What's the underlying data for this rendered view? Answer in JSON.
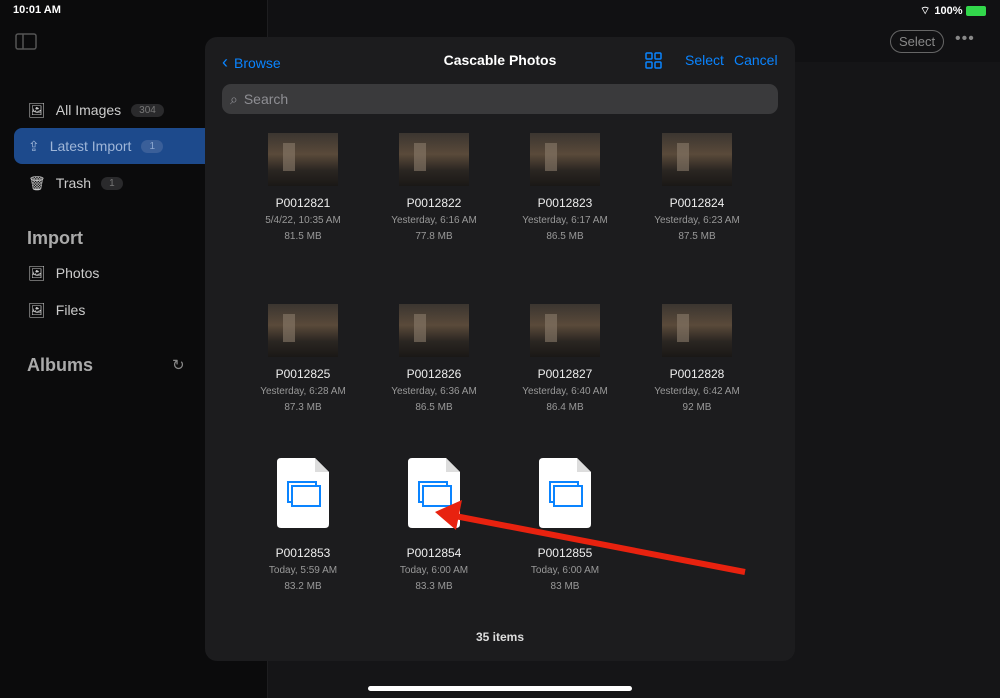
{
  "status": {
    "time": "10:01 AM",
    "battery": "100%"
  },
  "sidebar": {
    "items": [
      {
        "label": "All Images",
        "count": "304",
        "icon": "photo-icon"
      },
      {
        "label": "Latest Import",
        "count": "1",
        "icon": "import-icon"
      },
      {
        "label": "Trash",
        "count": "1",
        "icon": "trash-icon"
      }
    ],
    "import_title": "Import",
    "import_items": [
      {
        "label": "Photos"
      },
      {
        "label": "Files"
      }
    ],
    "albums_title": "Albums"
  },
  "toolbar": {
    "select_label": "Select"
  },
  "modal": {
    "back_label": "Browse",
    "title": "Cascable Photos",
    "select_label": "Select",
    "cancel_label": "Cancel",
    "search_placeholder": "Search",
    "footer": "35 items",
    "files": [
      {
        "name": "P0012821",
        "date": "5/4/22, 10:35 AM",
        "size": "81.5 MB",
        "type": "image"
      },
      {
        "name": "P0012822",
        "date": "Yesterday, 6:16 AM",
        "size": "77.8 MB",
        "type": "image"
      },
      {
        "name": "P0012823",
        "date": "Yesterday, 6:17 AM",
        "size": "86.5 MB",
        "type": "image"
      },
      {
        "name": "P0012824",
        "date": "Yesterday, 6:23 AM",
        "size": "87.5 MB",
        "type": "image"
      },
      {
        "name": "P0012825",
        "date": "Yesterday, 6:28 AM",
        "size": "87.3 MB",
        "type": "image"
      },
      {
        "name": "P0012826",
        "date": "Yesterday, 6:36 AM",
        "size": "86.5 MB",
        "type": "image"
      },
      {
        "name": "P0012827",
        "date": "Yesterday, 6:40 AM",
        "size": "86.4 MB",
        "type": "image"
      },
      {
        "name": "P0012828",
        "date": "Yesterday, 6:42 AM",
        "size": "92 MB",
        "type": "image"
      },
      {
        "name": "P0012853",
        "date": "Today, 5:59 AM",
        "size": "83.2 MB",
        "type": "document"
      },
      {
        "name": "P0012854",
        "date": "Today, 6:00 AM",
        "size": "83.3 MB",
        "type": "document"
      },
      {
        "name": "P0012855",
        "date": "Today, 6:00 AM",
        "size": "83 MB",
        "type": "document"
      }
    ]
  },
  "annotation": {
    "arrow_color": "#e8220f"
  }
}
